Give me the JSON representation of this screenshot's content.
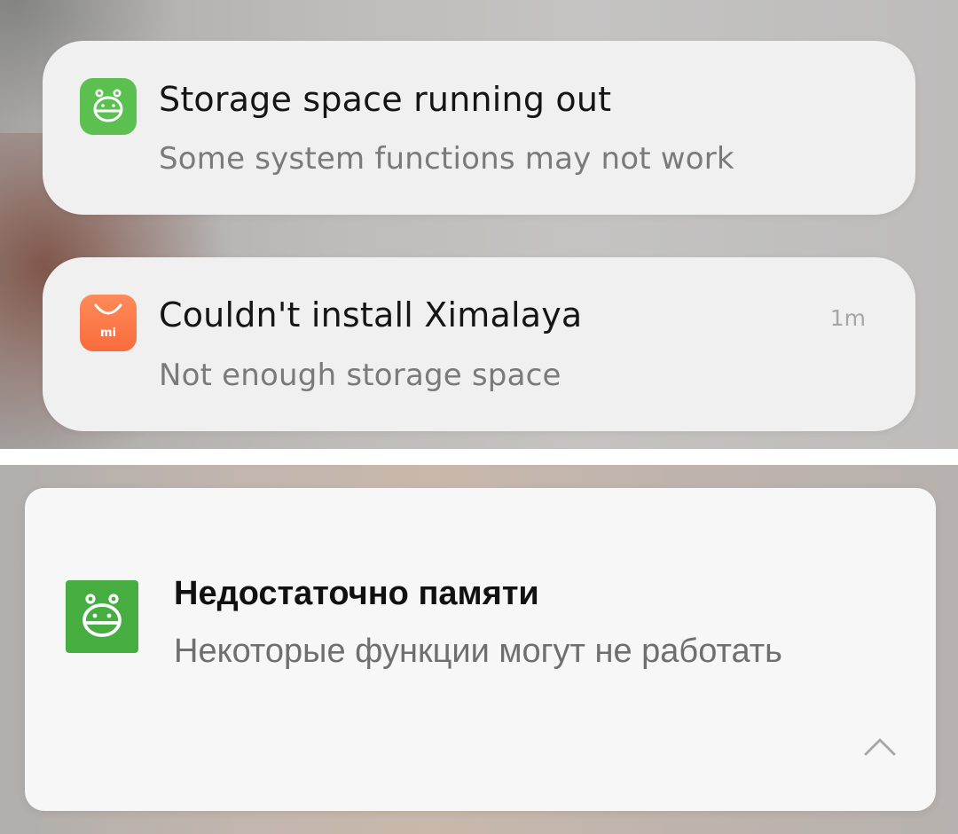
{
  "notifications_english": [
    {
      "icon": "security-app-robot-icon",
      "icon_color": "#5bc050",
      "title": "Storage space running out",
      "text": "Some system functions may not work"
    },
    {
      "icon": "mi-app-store-bag-icon",
      "icon_color": "#f96c3c",
      "title": "Couldn't install Ximalaya",
      "text": "Not enough storage space",
      "time": "1m"
    }
  ],
  "notification_russian": {
    "icon": "security-app-robot-icon",
    "icon_color": "#46ad41",
    "title": "Недостаточно памяти",
    "text": "Некоторые функции могут не работать",
    "collapse_icon": "chevron-up-icon"
  },
  "mi_logo_text": "mi"
}
